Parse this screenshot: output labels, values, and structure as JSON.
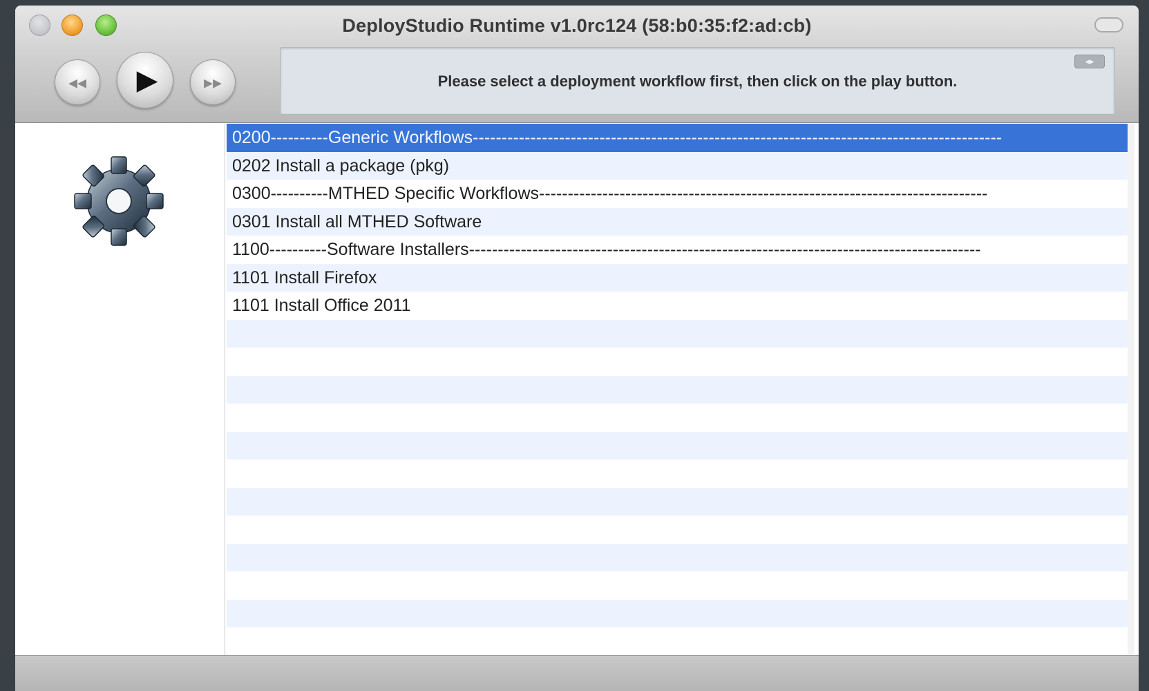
{
  "window": {
    "title": "DeployStudio Runtime v1.0rc124 (58:b0:35:f2:ad:cb)"
  },
  "toolbar": {
    "rewind_icon": "◂◂",
    "play_icon": "▶",
    "forward_icon": "▸▸",
    "status_message": "Please select a deployment workflow first, then click on the play button.",
    "status_toggle_icon": "◂▸"
  },
  "workflows": [
    {
      "label": "0200----------Generic Workflows--------------------------------------------------------------------------------------------",
      "selected": true
    },
    {
      "label": "0202 Install a package (pkg)",
      "selected": false
    },
    {
      "label": "0300----------MTHED Specific Workflows------------------------------------------------------------------------------",
      "selected": false
    },
    {
      "label": "0301 Install all MTHED Software",
      "selected": false
    },
    {
      "label": "1100----------Software Installers-----------------------------------------------------------------------------------------",
      "selected": false
    },
    {
      "label": "1101 Install Firefox",
      "selected": false
    },
    {
      "label": "1101 Install Office 2011",
      "selected": false
    }
  ],
  "colors": {
    "selection": "#3874d8",
    "alt_row": "#edf3fe"
  }
}
